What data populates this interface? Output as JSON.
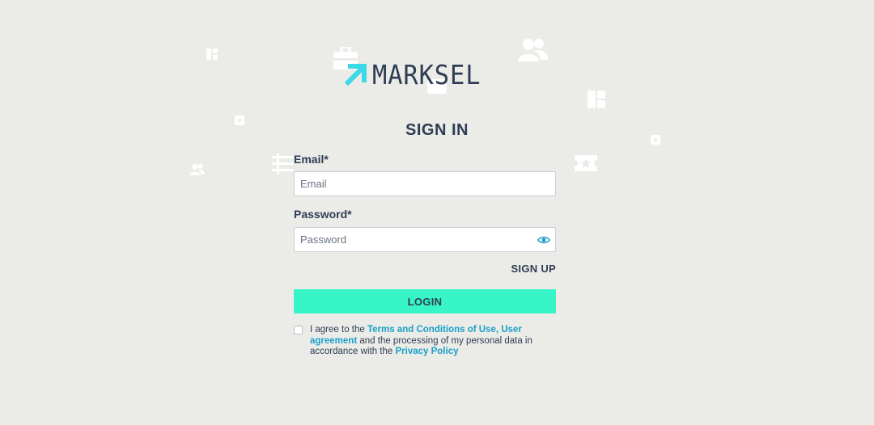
{
  "brand": {
    "logo_text": "MARKSEL"
  },
  "page": {
    "title": "SIGN IN"
  },
  "form": {
    "email_label": "Email*",
    "email_placeholder": "Email",
    "email_value": "",
    "password_label": "Password*",
    "password_placeholder": "Password",
    "password_value": "",
    "signup_label": "SIGN UP",
    "login_label": "LOGIN"
  },
  "consent": {
    "checked": false,
    "text_1": "I agree to the ",
    "terms_link": "Terms and Conditions of Use",
    "text_2": ", ",
    "agreement_link": "User agreement",
    "text_3": " and the processing of my personal data in accordance with the ",
    "privacy_link": "Privacy Policy"
  },
  "icons": {
    "logo_arrow": "arrow-up-right-icon",
    "password_toggle": "eye-icon",
    "background": [
      "widget-icon",
      "users-icon",
      "dashboard-icon",
      "plus-square-icon",
      "users-icon",
      "list-icon",
      "ticket-star-icon",
      "plus-square-icon",
      "briefcase-icon"
    ]
  },
  "colors": {
    "background": "#ebebe7",
    "text": "#2f3e55",
    "accent": "#37f5c6",
    "link": "#1aa0c8",
    "logo_arrow": "#3dd9e8"
  }
}
